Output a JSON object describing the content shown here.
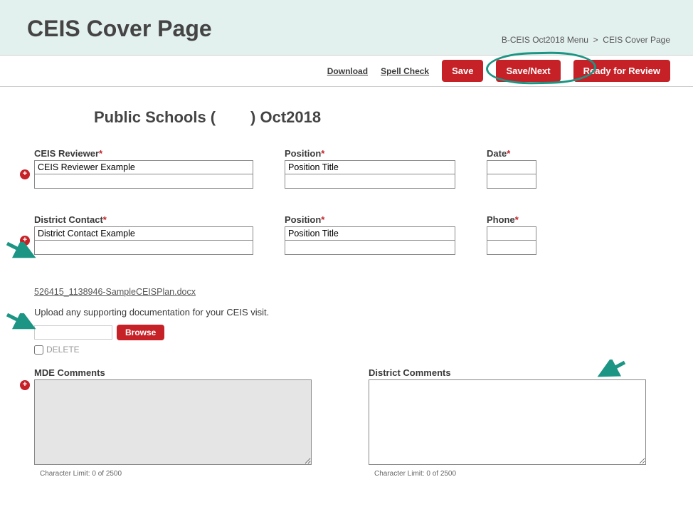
{
  "title": "CEIS Cover Page",
  "breadcrumb": {
    "link": "B-CEIS Oct2018 Menu",
    "sep": ">",
    "current": "CEIS Cover Page"
  },
  "toolbar": {
    "download": "Download",
    "spellcheck": "Spell Check",
    "save": "Save",
    "savenext": "Save/Next",
    "ready": "Ready for Review"
  },
  "subtitle_before": "Public Schools (",
  "subtitle_after": ") Oct2018",
  "section1": {
    "reviewer_label": "CEIS Reviewer",
    "reviewer_value": "CEIS Reviewer Example",
    "position_label": "Position",
    "position_value": "Position Title",
    "date_label": "Date"
  },
  "section2": {
    "contact_label": "District Contact",
    "contact_value": "District Contact Example",
    "position_label": "Position",
    "position_value": "Position Title",
    "phone_label": "Phone"
  },
  "file": {
    "link": "526415_1138946-SampleCEISPlan.docx",
    "instruction": "Upload any supporting documentation for your CEIS visit.",
    "browse": "Browse",
    "delete": "DELETE"
  },
  "comments": {
    "mde_label": "MDE Comments",
    "district_label": "District Comments",
    "charlimit": "Character Limit: 0 of 2500"
  }
}
